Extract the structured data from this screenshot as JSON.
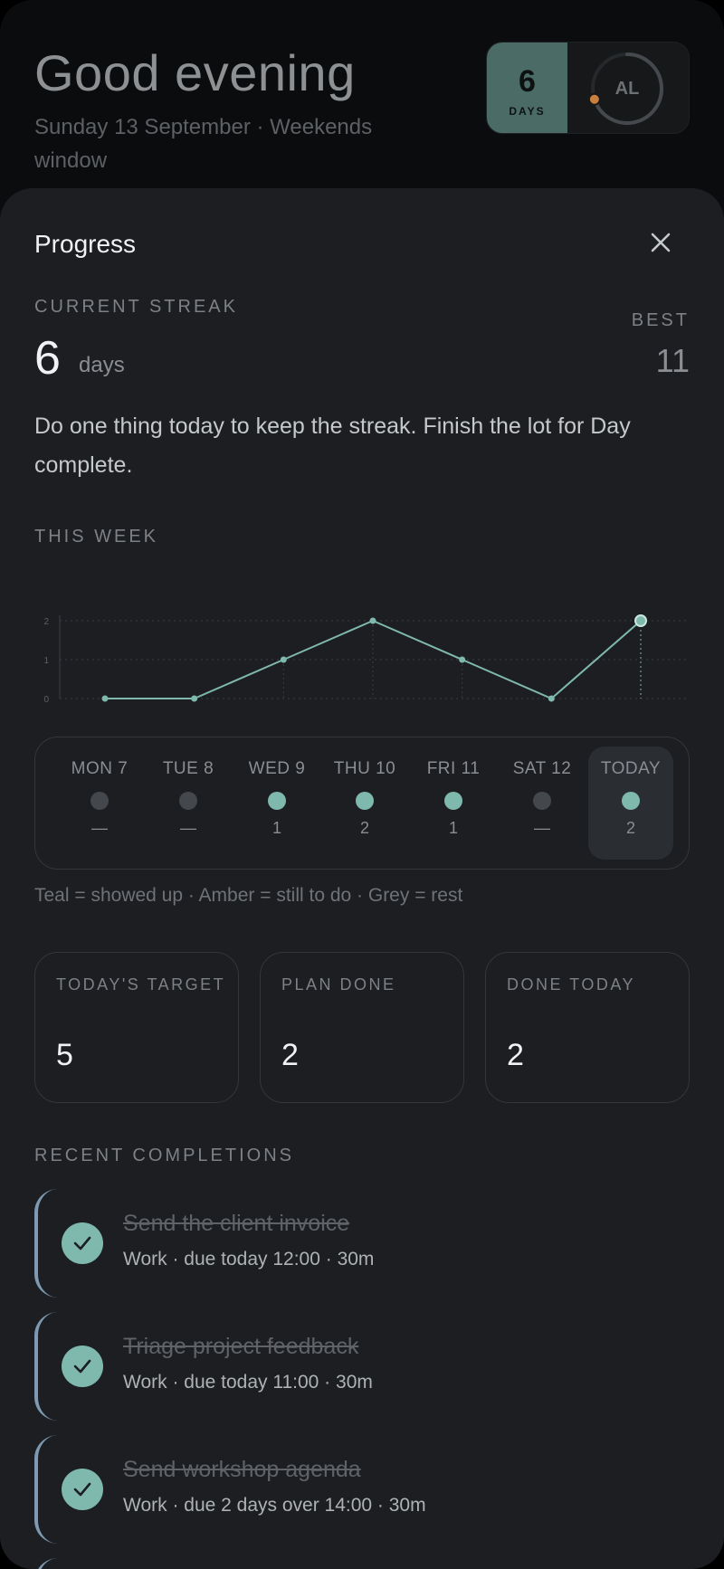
{
  "header": {
    "greeting": "Good evening",
    "subtitle": "Sunday 13 September · Weekends window",
    "streak_badge": {
      "value": "6",
      "label": "DAYS"
    },
    "avatar": {
      "initials": "AL",
      "ring_progress": 0.7
    }
  },
  "sheet": {
    "title": "Progress",
    "current_streak_label": "CURRENT STREAK",
    "current_streak_value": "6",
    "current_streak_unit": "days",
    "best_label": "BEST",
    "best_value": "11",
    "message": "Do one thing today to keep the streak. Finish the lot for Day complete.",
    "this_week_label": "THIS WEEK",
    "legend": "Teal = showed up · Amber = still to do · Grey = rest",
    "stats": [
      {
        "label": "TODAY'S TARGET",
        "value": "5"
      },
      {
        "label": "PLAN DONE",
        "value": "2"
      },
      {
        "label": "DONE TODAY",
        "value": "2"
      }
    ],
    "recent_label": "RECENT COMPLETIONS"
  },
  "chart_data": {
    "type": "line",
    "categories": [
      "MON 7",
      "TUE 8",
      "WED 9",
      "THU 10",
      "FRI 11",
      "SAT 12",
      "TODAY"
    ],
    "values": [
      0,
      0,
      1,
      2,
      1,
      0,
      2
    ],
    "ylim": [
      0,
      2
    ],
    "yticks": [
      "0",
      "1",
      "2"
    ],
    "grid": true,
    "highlight_index": 6
  },
  "week": [
    {
      "label": "MON 7",
      "status": "rest",
      "count": "—"
    },
    {
      "label": "TUE 8",
      "status": "rest",
      "count": "—"
    },
    {
      "label": "WED 9",
      "status": "done",
      "count": "1"
    },
    {
      "label": "THU 10",
      "status": "done",
      "count": "2"
    },
    {
      "label": "FRI 11",
      "status": "done",
      "count": "1"
    },
    {
      "label": "SAT 12",
      "status": "rest",
      "count": "—"
    },
    {
      "label": "TODAY",
      "status": "done",
      "count": "2"
    }
  ],
  "completions": [
    {
      "title": "Send the client invoice",
      "meta": "Work · due today 12:00 · 30m"
    },
    {
      "title": "Triage project feedback",
      "meta": "Work · due today 11:00 · 30m"
    },
    {
      "title": "Send workshop agenda",
      "meta": "Work · due 2 days over 14:00 · 30m"
    }
  ],
  "colors": {
    "teal": "#7fb8ad",
    "grey": "#44474b",
    "amber": "#c9803f",
    "accent_border": "#7e9ab3"
  }
}
